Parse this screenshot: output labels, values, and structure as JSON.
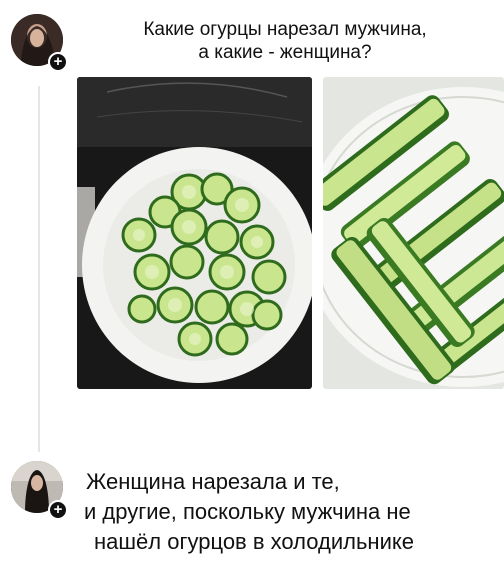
{
  "post": {
    "line1": "Какие огурцы нарезал мужчина,",
    "line2": "а какие - женщина?",
    "follow_badge": "+",
    "photos": [
      {
        "description_icon": "sliced-cucumber-rounds-image"
      },
      {
        "description_icon": "cucumber-spears-image"
      }
    ]
  },
  "reply": {
    "line1": "Женщина нарезала и те,",
    "line2": "и другие, поскольку мужчина не",
    "line3": "нашёл огурцов в холодильнике",
    "follow_badge": "+"
  },
  "colors": {
    "cucumber_skin": "#2f6b1c",
    "cucumber_flesh": "#c9e58e",
    "bowl": "#f4f4f2",
    "stove": "#1b1b1b",
    "plate_bg": "#e9ebe6"
  }
}
